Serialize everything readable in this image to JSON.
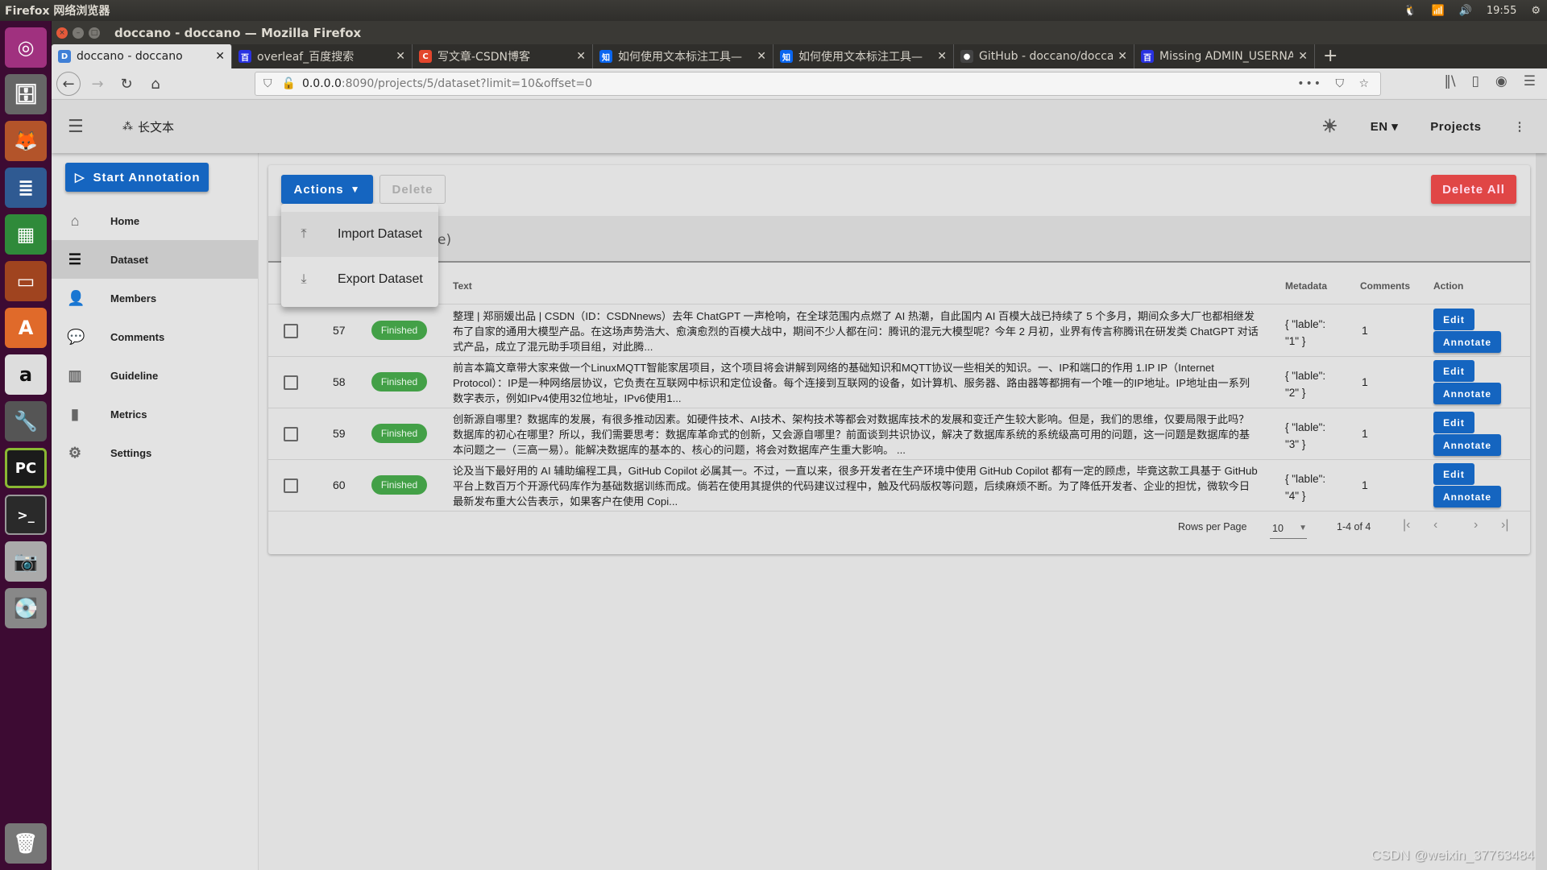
{
  "system": {
    "app_name": "Firefox 网络浏览器",
    "clock": "19:55"
  },
  "launcher": {
    "items": [
      "ubuntu-dash",
      "files",
      "firefox",
      "libreoffice-writer",
      "libreoffice-calc",
      "libreoffice-impress",
      "software-center",
      "amazon",
      "system-settings",
      "pycharm",
      "terminal",
      "camera",
      "disk",
      "trash"
    ]
  },
  "window": {
    "title": "doccano - doccano — Mozilla Firefox"
  },
  "tabs": [
    {
      "label": "doccano - doccano",
      "active": true,
      "favicon": "D",
      "color": "#3f7fd6"
    },
    {
      "label": "overleaf_百度搜索",
      "active": false,
      "favicon": "百",
      "color": "#2932e1"
    },
    {
      "label": "写文章-CSDN博客",
      "active": false,
      "favicon": "C",
      "color": "#e3462c"
    },
    {
      "label": "如何使用文本标注工具—",
      "active": false,
      "favicon": "知",
      "color": "#0a66f0"
    },
    {
      "label": "如何使用文本标注工具—",
      "active": false,
      "favicon": "知",
      "color": "#0a66f0"
    },
    {
      "label": "GitHub - doccano/doccano",
      "active": false,
      "favicon": "●",
      "color": "#444444"
    },
    {
      "label": "Missing ADMIN_USERNAME",
      "active": false,
      "favicon": "百",
      "color": "#2932e1"
    }
  ],
  "url": {
    "host": "0.0.0.0",
    "path": ":8090/projects/5/dataset?limit=10&offset=0"
  },
  "appbar": {
    "project_name": "长文本",
    "language": "EN",
    "projects_label": "Projects"
  },
  "sidebar": {
    "start_annotation": "Start Annotation",
    "items": [
      {
        "label": "Home",
        "icon": "home-icon",
        "active": false
      },
      {
        "label": "Dataset",
        "icon": "database-icon",
        "active": true
      },
      {
        "label": "Members",
        "icon": "person-icon",
        "active": false
      },
      {
        "label": "Comments",
        "icon": "comment-icon",
        "active": false
      },
      {
        "label": "Guideline",
        "icon": "book-icon",
        "active": false
      },
      {
        "label": "Metrics",
        "icon": "bar-chart-icon",
        "active": false
      },
      {
        "label": "Settings",
        "icon": "gear-icon",
        "active": false
      }
    ]
  },
  "toolbar": {
    "actions_label": "Actions",
    "delete_label": "Delete",
    "delete_all_label": "Delete All"
  },
  "actions_menu": {
    "items": [
      {
        "label": "Import Dataset",
        "icon": "upload-icon"
      },
      {
        "label": "Export Dataset",
        "icon": "download-icon"
      }
    ]
  },
  "search": {
    "visible_fragment": "e)"
  },
  "table": {
    "headers": {
      "text": "Text",
      "metadata": "Metadata",
      "comments": "Comments",
      "action": "Action"
    },
    "edit_label": "Edit",
    "annotate_label": "Annotate",
    "rows": [
      {
        "id": "57",
        "status": "Finished",
        "text": "整理 | 郑丽媛出品 | CSDN（ID：CSDNnews）去年 ChatGPT 一声枪响，在全球范围内点燃了 AI 热潮，自此国内 AI 百模大战已持续了 5 个多月，期间众多大厂也都相继发布了自家的通用大模型产品。在这场声势浩大、愈演愈烈的百模大战中，期间不少人都在问：腾讯的混元大模型呢？今年 2 月初，业界有传言称腾讯在研发类 ChatGPT 对话式产品，成立了混元助手项目组，对此腾...",
        "metadata_line1": "{ \"lable\":",
        "metadata_line2": "\"1\" }",
        "comments": "1"
      },
      {
        "id": "58",
        "status": "Finished",
        "text": "前言本篇文章带大家来做一个LinuxMQTT智能家居项目，这个项目将会讲解到网络的基础知识和MQTT协议一些相关的知识。一、IP和端口的作用 1.IP IP（Internet Protocol）：IP是一种网络层协议，它负责在互联网中标识和定位设备。每个连接到互联网的设备，如计算机、服务器、路由器等都拥有一个唯一的IP地址。IP地址由一系列数字表示，例如IPv4使用32位地址，IPv6使用1...",
        "metadata_line1": "{ \"lable\":",
        "metadata_line2": "\"2\" }",
        "comments": "1"
      },
      {
        "id": "59",
        "status": "Finished",
        "text": "创新源自哪里？数据库的发展，有很多推动因素。如硬件技术、AI技术、架构技术等都会对数据库技术的发展和变迁产生较大影响。但是，我们的思维，仅要局限于此吗？数据库的初心在哪里？所以，我们需要思考：数据库革命式的创新，又会源自哪里？前面谈到共识协议，解决了数据库系统的系统级高可用的问题，这一问题是数据库的基本问题之一（三高一易）。能解决数据库的基本的、核心的问题，将会对数据库产生重大影响。 ...",
        "metadata_line1": "{ \"lable\":",
        "metadata_line2": "\"3\" }",
        "comments": "1"
      },
      {
        "id": "60",
        "status": "Finished",
        "text": "论及当下最好用的 AI 辅助编程工具，GitHub Copilot 必属其一。不过，一直以来，很多开发者在生产环境中使用 GitHub Copilot 都有一定的顾虑，毕竟这款工具基于 GitHub 平台上数百万个开源代码库作为基础数据训练而成。倘若在使用其提供的代码建议过程中，触及代码版权等问题，后续麻烦不断。为了降低开发者、企业的担忧，微软今日最新发布重大公告表示，如果客户在使用 Copi...",
        "metadata_line1": "{ \"lable\":",
        "metadata_line2": "\"4\" }",
        "comments": "1"
      }
    ]
  },
  "pagination": {
    "rows_per_page_label": "Rows per Page",
    "rows_per_page_value": "10",
    "range": "1-4 of 4"
  },
  "watermark": "CSDN @weixin_37763484",
  "colors": {
    "primary": "#1565c0",
    "danger": "#e04646",
    "success": "#43a047"
  }
}
